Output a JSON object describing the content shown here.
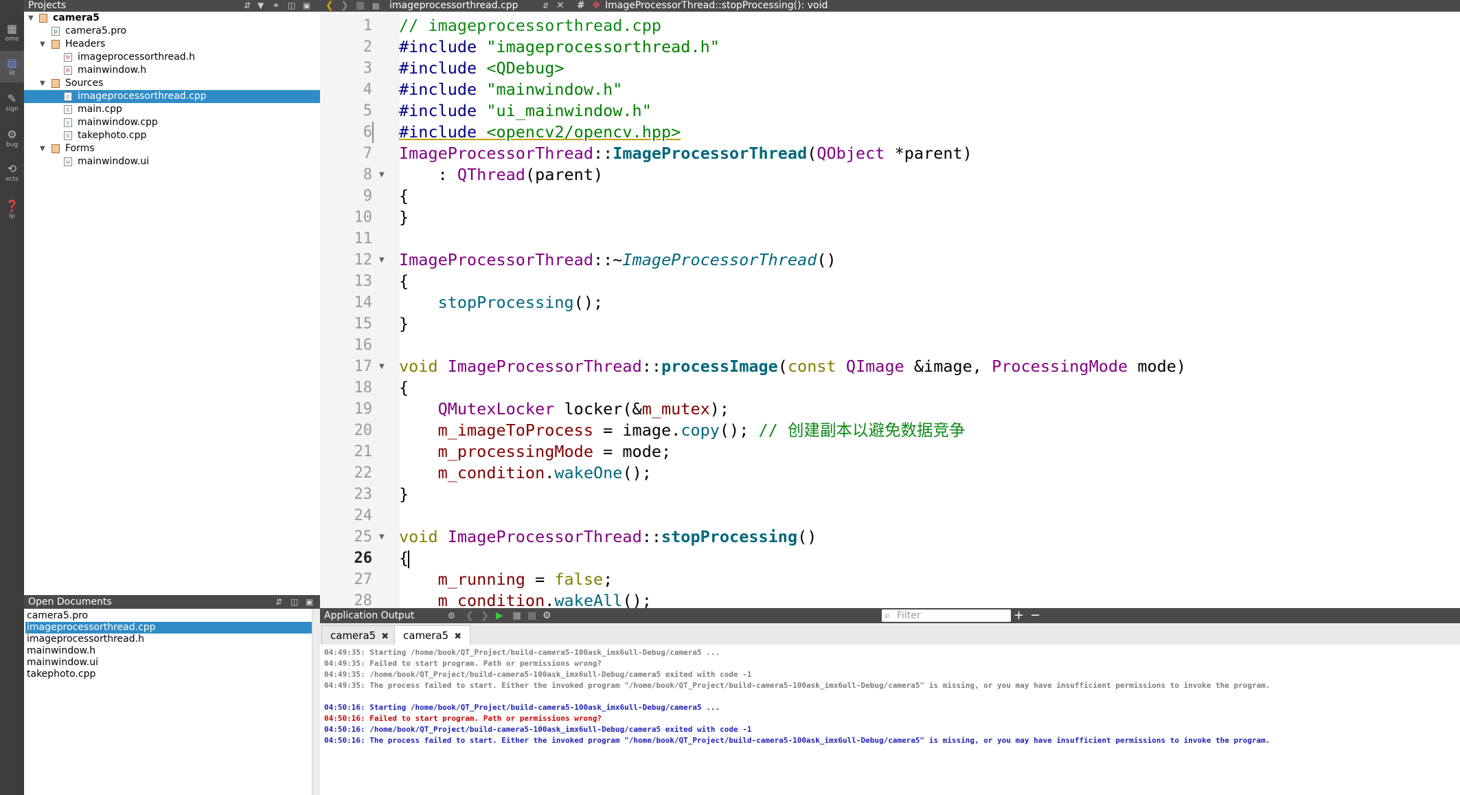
{
  "mode_bar": {
    "items": [
      {
        "label": "ome",
        "icon": "grid-icon"
      },
      {
        "label": "lit",
        "icon": "edit-icon"
      },
      {
        "label": "sign",
        "icon": "design-icon"
      },
      {
        "label": "bug",
        "icon": "bug-icon"
      },
      {
        "label": "ects",
        "icon": "wrench-icon"
      },
      {
        "label": "lp",
        "icon": "help-icon"
      }
    ]
  },
  "projects_pane": {
    "title": "Projects",
    "tree": [
      {
        "label": "camera5",
        "depth": 0,
        "kind": "project",
        "expanded": true,
        "bold": true
      },
      {
        "label": "camera5.pro",
        "depth": 1,
        "kind": "pro"
      },
      {
        "label": "Headers",
        "depth": 1,
        "kind": "folder",
        "expanded": true
      },
      {
        "label": "imageprocessorthread.h",
        "depth": 2,
        "kind": "h"
      },
      {
        "label": "mainwindow.h",
        "depth": 2,
        "kind": "h"
      },
      {
        "label": "Sources",
        "depth": 1,
        "kind": "folder",
        "expanded": true
      },
      {
        "label": "imageprocessorthread.cpp",
        "depth": 2,
        "kind": "cpp",
        "selected": true
      },
      {
        "label": "main.cpp",
        "depth": 2,
        "kind": "cpp"
      },
      {
        "label": "mainwindow.cpp",
        "depth": 2,
        "kind": "cpp"
      },
      {
        "label": "takephoto.cpp",
        "depth": 2,
        "kind": "cpp"
      },
      {
        "label": "Forms",
        "depth": 1,
        "kind": "folder",
        "expanded": true
      },
      {
        "label": "mainwindow.ui",
        "depth": 2,
        "kind": "ui"
      }
    ]
  },
  "open_documents": {
    "title": "Open Documents",
    "items": [
      {
        "label": "camera5.pro"
      },
      {
        "label": "imageprocessorthread.cpp",
        "selected": true
      },
      {
        "label": "imageprocessorthread.h"
      },
      {
        "label": "mainwindow.h"
      },
      {
        "label": "mainwindow.ui"
      },
      {
        "label": "takephoto.cpp"
      }
    ]
  },
  "editor": {
    "file_name": "imageprocessorthread.cpp",
    "symbol": "ImageProcessorThread::stopProcessing(): void",
    "hash": "#",
    "current_line": 26,
    "lines": [
      {
        "n": "1",
        "code": "// imageprocessorthread.cpp"
      },
      {
        "n": "2",
        "code": "#include \"imageprocessorthread.h\""
      },
      {
        "n": "3",
        "code": "#include <QDebug>"
      },
      {
        "n": "4",
        "code": "#include \"mainwindow.h\""
      },
      {
        "n": "5",
        "code": "#include \"ui_mainwindow.h\""
      },
      {
        "n": "6",
        "code": "#include <opencv2/opencv.hpp>"
      },
      {
        "n": "7",
        "code": "ImageProcessorThread::ImageProcessorThread(QObject *parent)"
      },
      {
        "n": "8",
        "code": "    : QThread(parent)"
      },
      {
        "n": "9",
        "code": "{"
      },
      {
        "n": "10",
        "code": "}"
      },
      {
        "n": "11",
        "code": ""
      },
      {
        "n": "12",
        "code": "ImageProcessorThread::~ImageProcessorThread()"
      },
      {
        "n": "13",
        "code": "{"
      },
      {
        "n": "14",
        "code": "    stopProcessing();"
      },
      {
        "n": "15",
        "code": "}"
      },
      {
        "n": "16",
        "code": ""
      },
      {
        "n": "17",
        "code": "void ImageProcessorThread::processImage(const QImage &image, ProcessingMode mode)"
      },
      {
        "n": "18",
        "code": "{"
      },
      {
        "n": "19",
        "code": "    QMutexLocker locker(&m_mutex);"
      },
      {
        "n": "20",
        "code": "    m_imageToProcess = image.copy(); // 创建副本以避免数据竞争"
      },
      {
        "n": "21",
        "code": "    m_processingMode = mode;"
      },
      {
        "n": "22",
        "code": "    m_condition.wakeOne();"
      },
      {
        "n": "23",
        "code": "}"
      },
      {
        "n": "24",
        "code": ""
      },
      {
        "n": "25",
        "code": "void ImageProcessorThread::stopProcessing()"
      },
      {
        "n": "26",
        "code": "{"
      },
      {
        "n": "27",
        "code": "    m_running = false;"
      },
      {
        "n": "28",
        "code": "    m_condition.wakeAll();"
      }
    ]
  },
  "output_pane": {
    "title": "Application Output",
    "filter_placeholder": "Filter",
    "tabs": [
      {
        "label": "camera5"
      },
      {
        "label": "camera5",
        "active": true
      }
    ],
    "lines": [
      {
        "text": "04:49:35: Starting /home/book/QT_Project/build-camera5-100ask_imx6ull-Debug/camera5 ...",
        "style": "gray"
      },
      {
        "text": "04:49:35: Failed to start program. Path or permissions wrong?",
        "style": "gray"
      },
      {
        "text": "04:49:35: /home/book/QT_Project/build-camera5-100ask_imx6ull-Debug/camera5 exited with code -1",
        "style": "gray"
      },
      {
        "text": "04:49:35: The process failed to start. Either the invoked program \"/home/book/QT_Project/build-camera5-100ask_imx6ull-Debug/camera5\" is missing, or you may have insufficient permissions to invoke the program.",
        "style": "gray"
      },
      {
        "text": "",
        "style": "gray"
      },
      {
        "text": "04:50:16: Starting /home/book/QT_Project/build-camera5-100ask_imx6ull-Debug/camera5 ...",
        "style": "blue"
      },
      {
        "text": "04:50:16: Failed to start program. Path or permissions wrong?",
        "style": "red"
      },
      {
        "text": "04:50:16: /home/book/QT_Project/build-camera5-100ask_imx6ull-Debug/camera5 exited with code -1",
        "style": "blue"
      },
      {
        "text": "04:50:16: The process failed to start. Either the invoked program \"/home/book/QT_Project/build-camera5-100ask_imx6ull-Debug/camera5\" is missing, or you may have insufficient permissions to invoke the program.",
        "style": "blue"
      }
    ]
  }
}
